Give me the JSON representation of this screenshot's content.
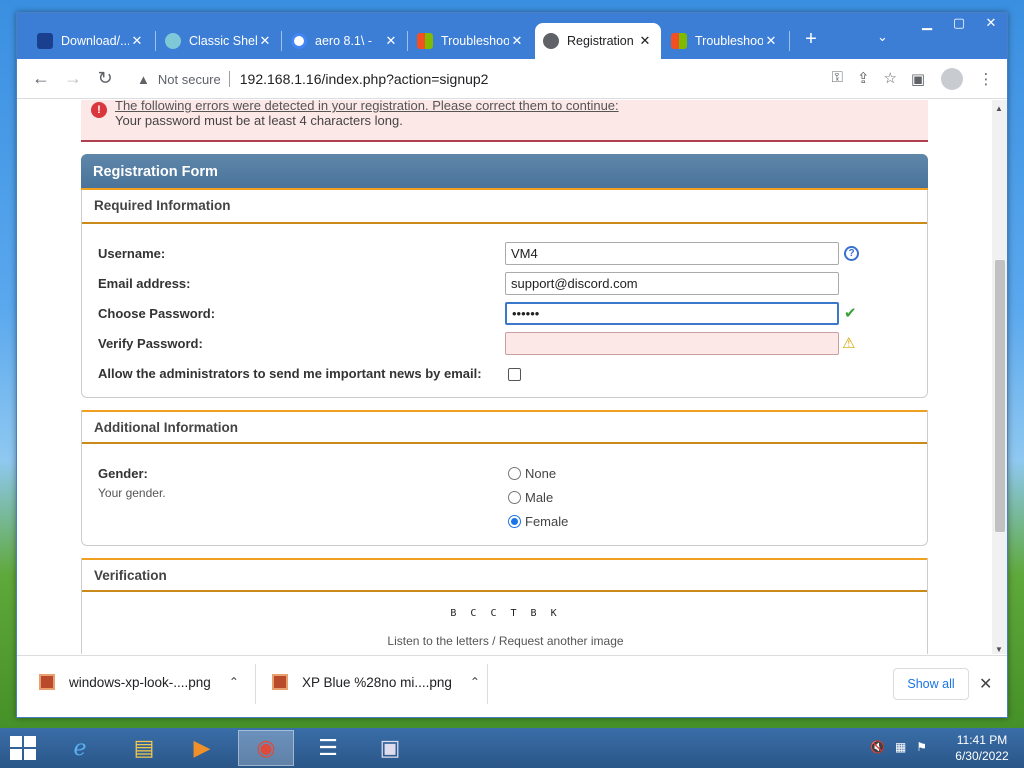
{
  "browser": {
    "tabs": [
      {
        "title": "Download/...",
        "icon": "download-site-icon",
        "active": false
      },
      {
        "title": "Classic Shel",
        "icon": "shell-icon",
        "active": false
      },
      {
        "title": "aero 8.1\\ - ",
        "icon": "google-icon",
        "active": false
      },
      {
        "title": "Troubleshoo",
        "icon": "windows-icon",
        "active": false
      },
      {
        "title": "Registration",
        "icon": "globe-icon",
        "active": true
      },
      {
        "title": "Troubleshoo",
        "icon": "windows-icon",
        "active": false
      }
    ],
    "security_label": "Not secure",
    "url": "192.168.1.16/index.php?action=signup2"
  },
  "errors": {
    "line1": "The following errors were detected in your registration. Please correct them to continue:",
    "line2": "Your password must be at least 4 characters long."
  },
  "form": {
    "title": "Registration Form",
    "required": {
      "heading": "Required Information",
      "username_label": "Username:",
      "username_value": "VM4",
      "email_label": "Email address:",
      "email_value": "support@discord.com",
      "password_label": "Choose Password:",
      "password_value": "••••••",
      "verify_label": "Verify Password:",
      "verify_value": "",
      "news_label": "Allow the administrators to send me important news by email:"
    },
    "additional": {
      "heading": "Additional Information",
      "gender_label": "Gender:",
      "gender_desc": "Your gender.",
      "options": [
        "None",
        "Male",
        "Female"
      ],
      "selected": "Female"
    },
    "verification": {
      "heading": "Verification",
      "captcha_text": "B C C T B K",
      "links": "Listen to the letters / Request another image"
    }
  },
  "downloads": {
    "items": [
      "windows-xp-look-....png",
      "XP Blue %28no mi....png"
    ],
    "show_all": "Show all"
  },
  "taskbar": {
    "time": "11:41 PM",
    "date": "6/30/2022"
  },
  "colors": {
    "tabstrip": "#3c7dd6",
    "form_header": "#4a739a",
    "accent_orange": "#f0a020",
    "error_bg": "#fde8e8"
  }
}
